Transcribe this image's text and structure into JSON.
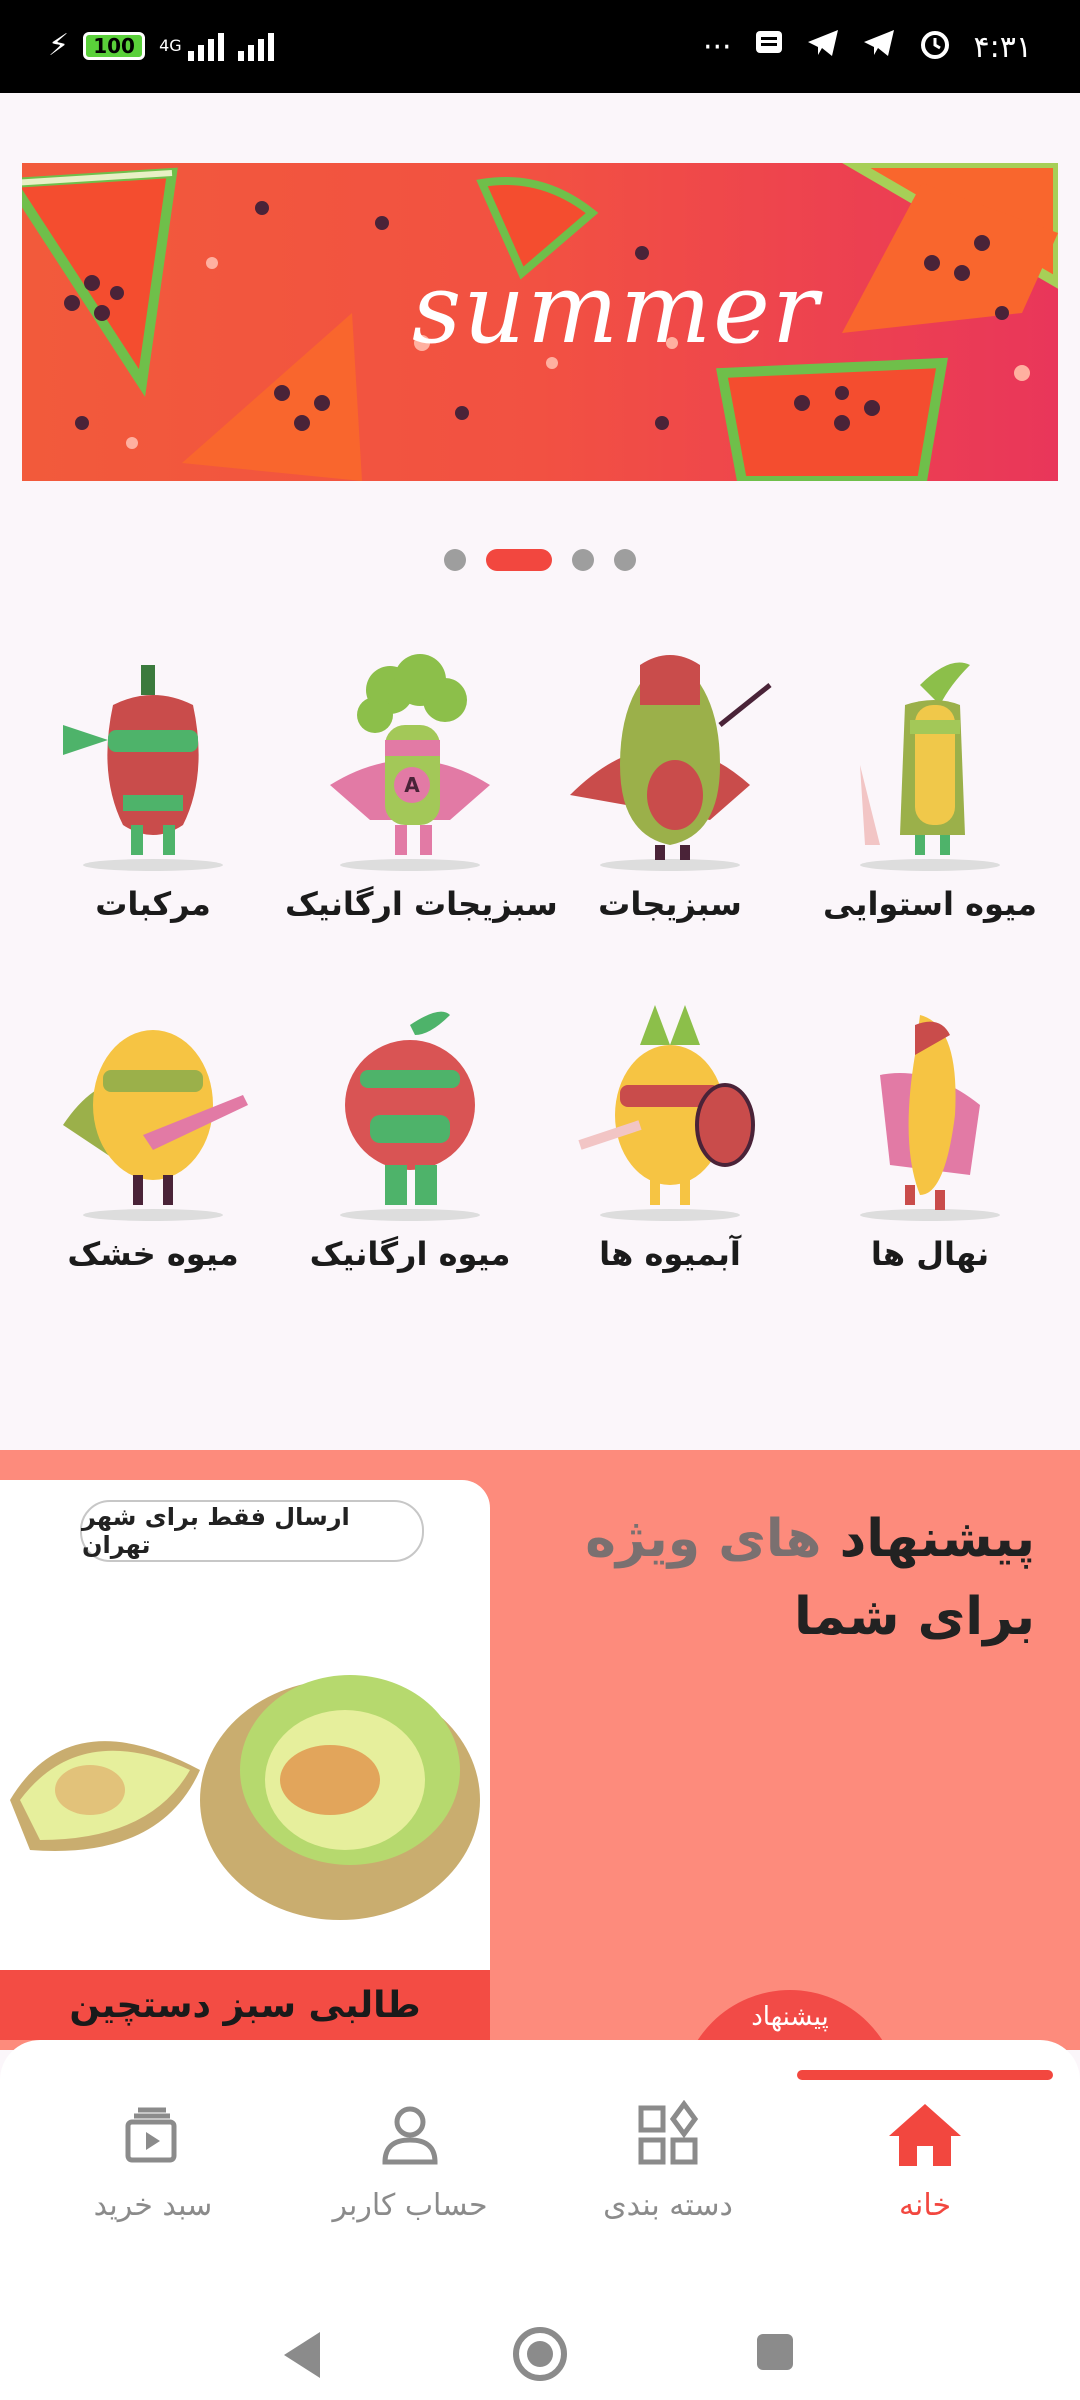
{
  "status_bar": {
    "battery": "100",
    "network": "4G",
    "dots": "···",
    "time": "۴:۳۱"
  },
  "banner": {
    "text": "summer",
    "slides_total": 4,
    "active_slide": 2
  },
  "categories": [
    {
      "label": "میوه استوایی",
      "icon": "corn-hero-icon"
    },
    {
      "label": "سبزیجات",
      "icon": "avocado-hero-icon"
    },
    {
      "label": "سبزیجات ارگانیک",
      "icon": "broccoli-hero-icon"
    },
    {
      "label": "مرکبات",
      "icon": "pepper-hero-icon"
    },
    {
      "label": "نهال ها",
      "icon": "banana-hero-icon"
    },
    {
      "label": "آبمیوه ها",
      "icon": "pineapple-hero-icon"
    },
    {
      "label": "میوه ارگانیک",
      "icon": "apple-hero-icon"
    },
    {
      "label": "میوه خشک",
      "icon": "lemon-hero-icon"
    }
  ],
  "offers": {
    "title_part1": "پیشنهاد",
    "title_part2": "های ویژه",
    "title_line2": "برای شما",
    "badge": "پیشنهاد",
    "card": {
      "pill": "ارسال فقط برای شهر تهران",
      "name": "طالبی سبز دستچین",
      "image": "melon-image"
    }
  },
  "bottom_nav": [
    {
      "label": "خانه",
      "icon": "home-icon",
      "active": true
    },
    {
      "label": "دسته بندی",
      "icon": "category-icon",
      "active": false
    },
    {
      "label": "حساب کاربر",
      "icon": "user-icon",
      "active": false
    },
    {
      "label": "سبد خرید",
      "icon": "cart-icon",
      "active": false
    }
  ],
  "colors": {
    "accent": "#f2473f",
    "offers_bg": "#fd8b7c",
    "page_bg": "#fbf6fa"
  }
}
